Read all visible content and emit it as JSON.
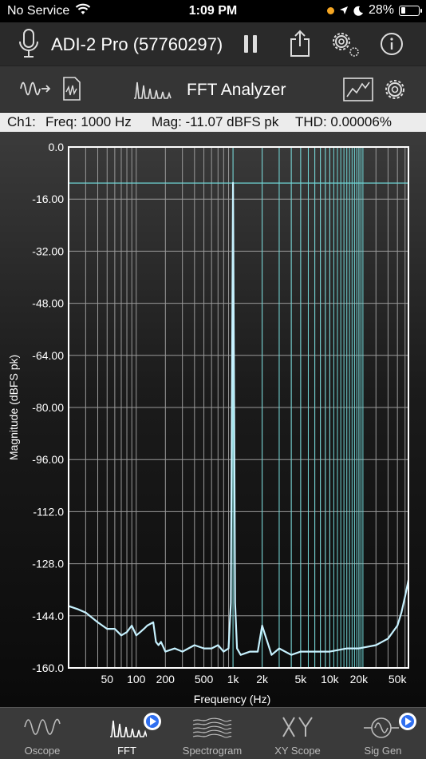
{
  "status_bar": {
    "carrier": "No Service",
    "time": "1:09 PM",
    "battery_percent": "28%",
    "battery_level": 0.28
  },
  "device_bar": {
    "device_name": "ADI-2 Pro (57760297)",
    "icons": [
      "microphone-icon",
      "pause-icon",
      "share-icon",
      "settings-gear-icon",
      "info-icon"
    ]
  },
  "toolbar": {
    "title": "FFT Analyzer",
    "icons": [
      "signal-input-icon",
      "wave-file-icon",
      "fft-peaks-icon",
      "graph-view-icon",
      "settings-gear-icon"
    ]
  },
  "info": {
    "channel": "Ch1:",
    "freq": "Freq: 1000 Hz",
    "mag": "Mag: -11.07 dBFS pk",
    "thd": "THD: 0.00006%"
  },
  "chart_data": {
    "type": "line",
    "xlabel": "Frequency (Hz)",
    "ylabel": "Magnitude (dBFS pk)",
    "xscale": "log",
    "xlim": [
      20,
      65000
    ],
    "ylim": [
      -160,
      0
    ],
    "x_ticks": [
      {
        "value": 50,
        "label": "50"
      },
      {
        "value": 100,
        "label": "100"
      },
      {
        "value": 200,
        "label": "200"
      },
      {
        "value": 500,
        "label": "500"
      },
      {
        "value": 1000,
        "label": "1k"
      },
      {
        "value": 2000,
        "label": "2k"
      },
      {
        "value": 5000,
        "label": "5k"
      },
      {
        "value": 10000,
        "label": "10k"
      },
      {
        "value": 20000,
        "label": "20k"
      },
      {
        "value": 50000,
        "label": "50k"
      }
    ],
    "y_ticks": [
      {
        "value": 0,
        "label": "0.0"
      },
      {
        "value": -16,
        "label": "-16.00"
      },
      {
        "value": -32,
        "label": "-32.00"
      },
      {
        "value": -48,
        "label": "-48.00"
      },
      {
        "value": -64,
        "label": "-64.00"
      },
      {
        "value": -80,
        "label": "-80.00"
      },
      {
        "value": -96,
        "label": "-96.00"
      },
      {
        "value": -112,
        "label": "-112.0"
      },
      {
        "value": -128,
        "label": "-128.0"
      },
      {
        "value": -144,
        "label": "-144.0"
      },
      {
        "value": -160,
        "label": "-160.0"
      }
    ],
    "grid": true,
    "peak_marker_level": -11.07,
    "harmonic_markers": [
      1000,
      2000,
      3000,
      4000,
      5000,
      6000,
      7000,
      8000,
      9000,
      10000,
      11000,
      12000,
      13000,
      14000,
      15000,
      16000,
      17000,
      18000,
      19000,
      20000,
      21000,
      22000
    ],
    "series": [
      {
        "x": [
          20,
          25,
          30,
          40,
          50,
          60,
          70,
          80,
          90,
          100,
          110,
          120,
          130,
          150,
          160,
          170,
          180,
          200,
          250,
          300,
          400,
          500,
          600,
          700,
          800,
          900,
          950,
          1000,
          1050,
          1100,
          1200,
          1500,
          1800,
          2000,
          2500,
          3000,
          4000,
          5000,
          7000,
          10000,
          15000,
          20000,
          30000,
          40000,
          50000,
          55000,
          60000,
          65000
        ],
        "y": [
          -141,
          -142,
          -143,
          -146,
          -148,
          -148,
          -150,
          -149,
          -147,
          -150,
          -149,
          -148,
          -147,
          -146,
          -152,
          -153,
          -152,
          -155,
          -154,
          -155,
          -153,
          -154,
          -154,
          -153,
          -155,
          -154,
          -140,
          -11,
          -140,
          -154,
          -156,
          -155,
          -155,
          -147,
          -156,
          -154,
          -156,
          -155,
          -155,
          -155,
          -154,
          -154,
          -153,
          -151,
          -147,
          -143,
          -138,
          -133
        ]
      }
    ]
  },
  "tabs": [
    {
      "label": "Oscope",
      "icon": "oscope-wave-icon",
      "active": false,
      "badge": false
    },
    {
      "label": "FFT",
      "icon": "fft-peaks-icon",
      "active": true,
      "badge": true
    },
    {
      "label": "Spectrogram",
      "icon": "spectrogram-icon",
      "active": false,
      "badge": false
    },
    {
      "label": "XY Scope",
      "icon": "xy-scope-icon",
      "active": false,
      "badge": false
    },
    {
      "label": "Sig Gen",
      "icon": "sine-generator-icon",
      "active": false,
      "badge": true
    }
  ]
}
